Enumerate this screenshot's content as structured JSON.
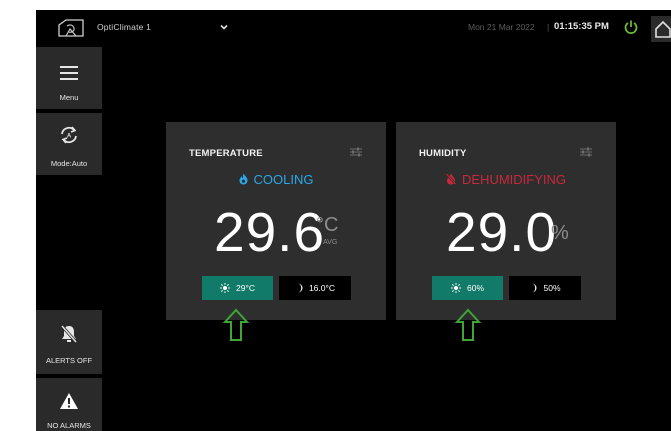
{
  "header": {
    "device_name": "OptiClimate 1",
    "date": "Mon 21 Mar 2022",
    "separator": "|",
    "time": "01:15:35 PM"
  },
  "sidebar": {
    "menu_label": "Menu",
    "mode_label": "Mode:Auto",
    "alerts_label": "ALERTS OFF",
    "alarms_label": "NO ALARMS"
  },
  "temperature": {
    "title": "TEMPERATURE",
    "status": "COOLING",
    "value": "29.6",
    "unit": "°C",
    "unit_sub": "AVG",
    "day_setpoint": "29°C",
    "night_setpoint": "16.0°C"
  },
  "humidity": {
    "title": "HUMIDITY",
    "status": "DEHUMIDIFYING",
    "value": "29.0",
    "unit": "%",
    "day_setpoint": "60%",
    "night_setpoint": "50%"
  },
  "colors": {
    "cooling": "#2aa8e8",
    "dehumidifying": "#c8283c",
    "day_setpoint_bg": "#127a68",
    "power": "#6fbf3a",
    "annotation_arrow": "#3fa535"
  },
  "icons": [
    "logo-icon",
    "chevron-down-icon",
    "power-icon",
    "home-icon",
    "hamburger-icon",
    "mode-auto-icon",
    "bell-off-icon",
    "warning-icon",
    "settings-sliders-icon",
    "flame-icon",
    "drop-off-icon",
    "sun-icon",
    "moon-icon",
    "arrow-up-icon"
  ]
}
